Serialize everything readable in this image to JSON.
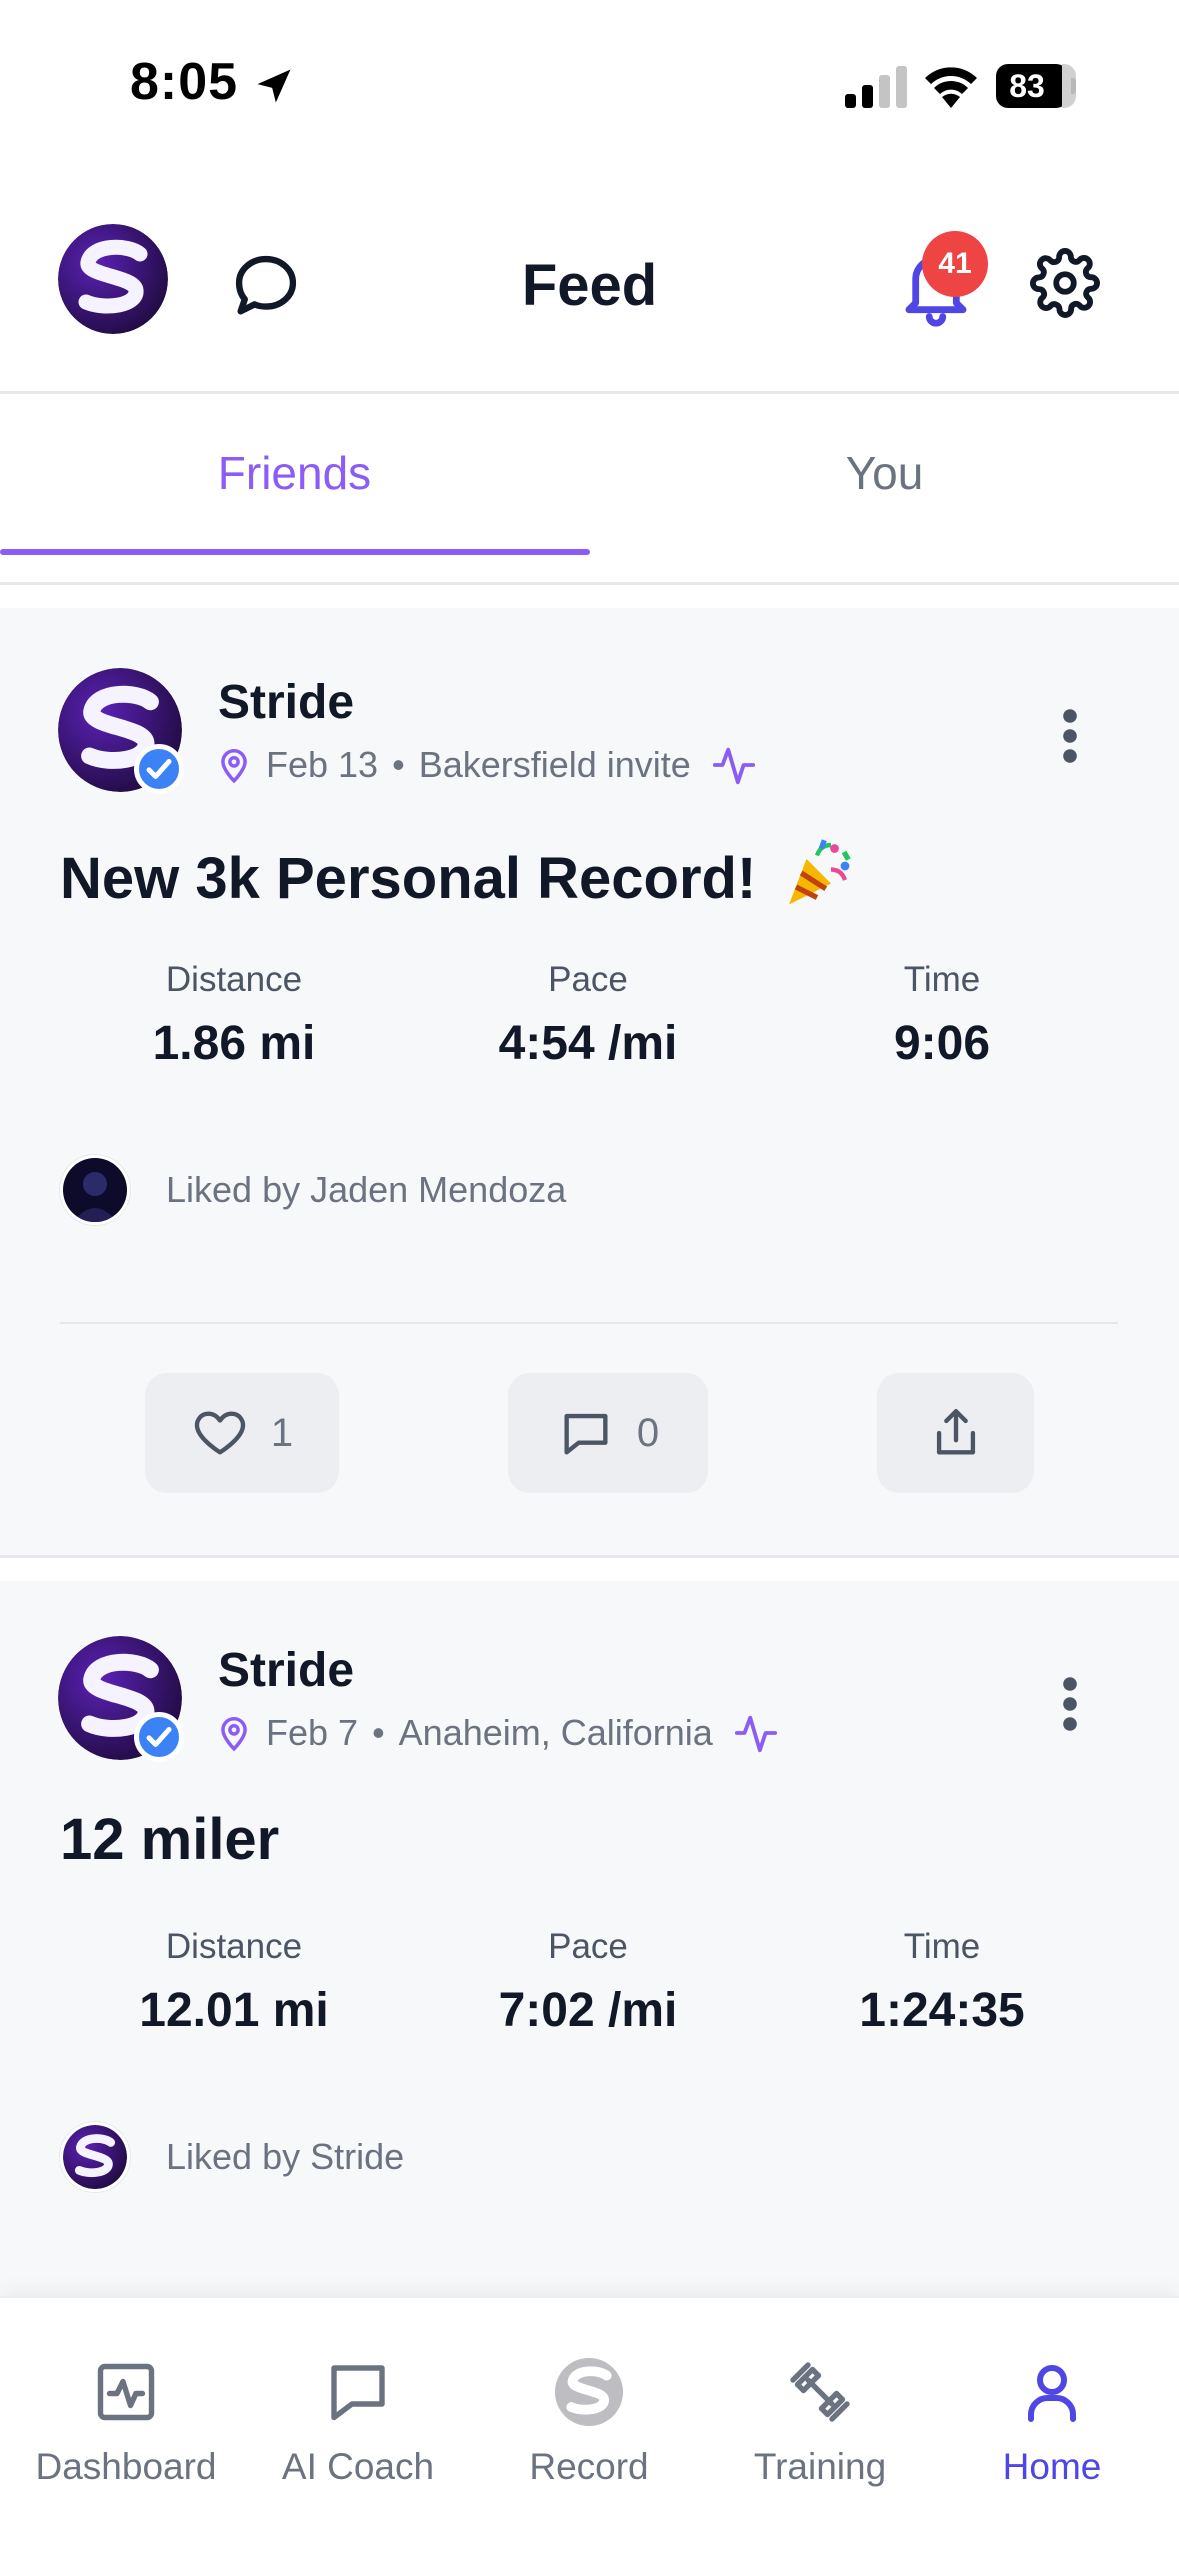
{
  "status_bar": {
    "time": "8:05",
    "battery": "83"
  },
  "header": {
    "title": "Feed",
    "notification_count": "41"
  },
  "tabs": [
    {
      "label": "Friends",
      "active": true
    },
    {
      "label": "You",
      "active": false
    }
  ],
  "posts": [
    {
      "author": "Stride",
      "date": "Feb 13",
      "location": "Bakersfield invite",
      "separator": "•",
      "title": "New 3k Personal Record!",
      "title_emoji": "party-popper-icon",
      "stats": [
        {
          "label": "Distance",
          "value": "1.86 mi"
        },
        {
          "label": "Pace",
          "value": "4:54 /mi"
        },
        {
          "label": "Time",
          "value": "9:06"
        }
      ],
      "liked_by": "Liked by Jaden Mendoza",
      "like_count": "1",
      "comment_count": "0"
    },
    {
      "author": "Stride",
      "date": "Feb 7",
      "location": "Anaheim, California",
      "separator": "•",
      "title": "12 miler",
      "stats": [
        {
          "label": "Distance",
          "value": "12.01 mi"
        },
        {
          "label": "Pace",
          "value": "7:02 /mi"
        },
        {
          "label": "Time",
          "value": "1:24:35"
        }
      ],
      "liked_by": "Liked by Stride"
    }
  ],
  "bottom_nav": [
    {
      "label": "Dashboard",
      "icon": "activity-chart-icon"
    },
    {
      "label": "AI Coach",
      "icon": "chat-bubble-icon"
    },
    {
      "label": "Record",
      "icon": "stride-logo-icon"
    },
    {
      "label": "Training",
      "icon": "dumbbell-icon"
    },
    {
      "label": "Home",
      "icon": "person-icon",
      "active": true
    }
  ],
  "colors": {
    "accent": "#8b5cf6",
    "nav_active": "#4f46e5",
    "badge": "#ef4444",
    "verified": "#3b82f6",
    "card_bg": "#f7f8fa"
  }
}
